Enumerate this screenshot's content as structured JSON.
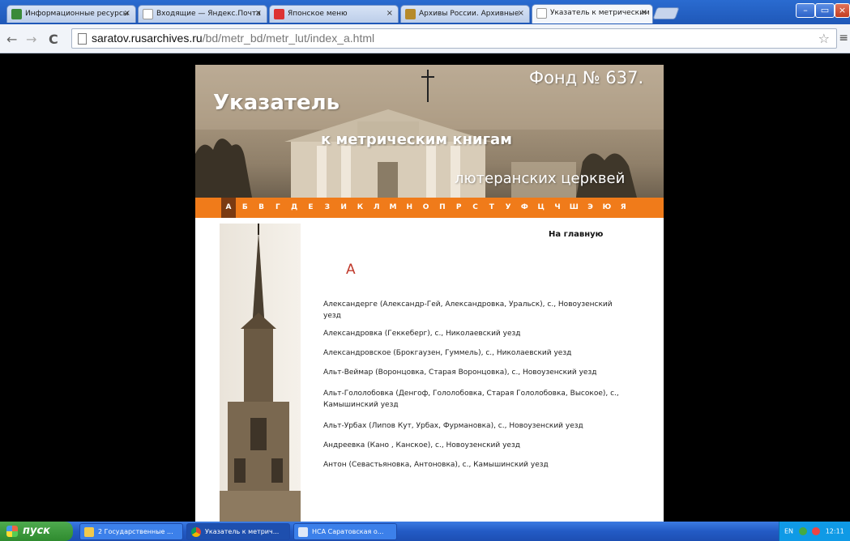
{
  "browser": {
    "tabs": [
      {
        "label": "Информационные ресурсы",
        "close": "×"
      },
      {
        "label": "Входящие — Яндекс.Почта",
        "close": "×"
      },
      {
        "label": "Японское меню",
        "close": "×"
      },
      {
        "label": "Архивы России. Архивные",
        "close": "×"
      },
      {
        "label": "Указатель к метрическим",
        "close": "×"
      }
    ],
    "window_buttons": [
      "–",
      "▭",
      "×"
    ],
    "url_host": "saratov.rusarchives.ru",
    "url_path": "/bd/metr_bd/metr_lut/index_a.html",
    "nav": {
      "back": "←",
      "forward": "→",
      "reload": "C"
    },
    "star": "☆",
    "menu": "≡"
  },
  "page": {
    "banner": {
      "fond": "Фонд № 637.",
      "title1": "Указатель",
      "title2": "к метрическим книгам",
      "title3": "лютеранских церквей"
    },
    "alphabet": [
      "А",
      "Б",
      "В",
      "Г",
      "Д",
      "Е",
      "З",
      "И",
      "К",
      "Л",
      "М",
      "Н",
      "О",
      "П",
      "Р",
      "С",
      "Т",
      "У",
      "Ф",
      "Ц",
      "Ч",
      "Ш",
      "Э",
      "Ю",
      "Я"
    ],
    "selected_letter": "А",
    "home_link": "На главную",
    "letter_heading": "А",
    "entries": [
      "Александерге (Александр-Гей, Александровка, Уральск), с., Новоузенский уезд",
      "Александровка (Геккеберг), с., Николаевский уезд",
      "Александровское (Брокгаузен, Гуммель), с., Николаевский уезд",
      "Альт-Веймар (Воронцовка, Старая Воронцовка), с., Новоузенский уезд",
      "Альт-Гололобовка (Денгоф, Гололобовка, Старая Гололобовка, Высокое), с., Камышинский уезд",
      "Альт-Урбах (Липов Кут, Урбах, Фурмановка), с., Новоузенский уезд",
      "Андреевка (Кано , Канское), с., Новоузенский уезд",
      "Антон (Севастьяновка, Антоновка), с., Камышинский уезд"
    ]
  },
  "taskbar": {
    "start": "пуск",
    "tasks": [
      "2 Государственные ...",
      "Указатель к метрич...",
      "НСА Саратовская о..."
    ],
    "tray": "EN",
    "clock": "12:11"
  },
  "colors": {
    "accent_orange": "#f07b1a",
    "selected_letter_bg": "#7a3a12",
    "letter_heading": "#c0392b"
  }
}
